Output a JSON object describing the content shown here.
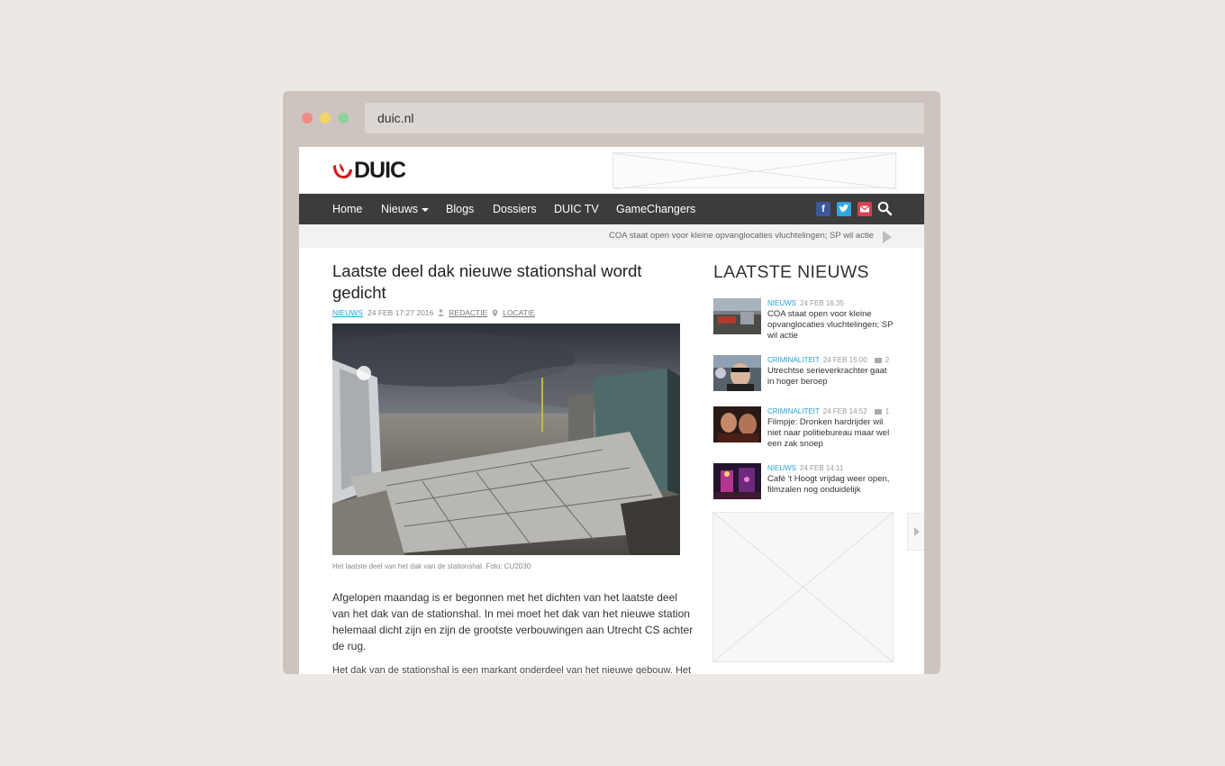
{
  "browser": {
    "url": "duic.nl",
    "dots": [
      "#f28b82",
      "#f6d365",
      "#8fd19e"
    ]
  },
  "site": {
    "logo_text": "DUIC",
    "brand_color": "#d71a1a"
  },
  "nav": {
    "items": [
      "Home",
      "Nieuws",
      "Blogs",
      "Dossiers",
      "DUIC TV",
      "GameChangers"
    ],
    "social": [
      "facebook-icon",
      "twitter-icon",
      "mail-icon",
      "search-icon"
    ]
  },
  "ticker": {
    "text": "COA staat open voor kleine opvanglocaties vluchtelingen; SP wil actie"
  },
  "article": {
    "title": "Laatste deel dak nieuwe stationshal wordt gedicht",
    "category": "NIEUWS",
    "date": "24 FEB 17:27 2016",
    "author": "REDACTIE",
    "location": "LOCATIE",
    "caption": "Het laatste deel van het dak van de stationshal. Foto: CU2030",
    "lead": "Afgelopen maandag is er begonnen met het dichten van het laatste deel van het dak van de stationshal. In mei moet het dak van het nieuwe station helemaal dicht zijn en zijn de grootste verbouwingen aan Utrecht CS achter de rug.",
    "body": "Het dak van de stationshal is een markant onderdeel van het nieuwe gebouw. Het"
  },
  "sidebar": {
    "title": "LAATSTE NIEUWS",
    "items": [
      {
        "category": "NIEUWS",
        "date": "24 FEB 16:35",
        "comments": "",
        "headline": "COA staat open voor kleine opvanglocaties vluchtelingen; SP wil actie"
      },
      {
        "category": "CRIMINALITEIT",
        "date": "24 FEB 15:00",
        "comments": "2",
        "headline": "Utrechtse serieverkrachter gaat in hoger beroep"
      },
      {
        "category": "CRIMINALITEIT",
        "date": "24 FEB 14:52",
        "comments": "1",
        "headline": "Filmpje: Dronken hardrijder wil niet naar politiebureau maar wel een zak snoep"
      },
      {
        "category": "NIEUWS",
        "date": "24 FEB 14:11",
        "comments": "",
        "headline": "Café 't Hoogt vrijdag weer open, filmzalen nog onduidelijk"
      }
    ]
  }
}
